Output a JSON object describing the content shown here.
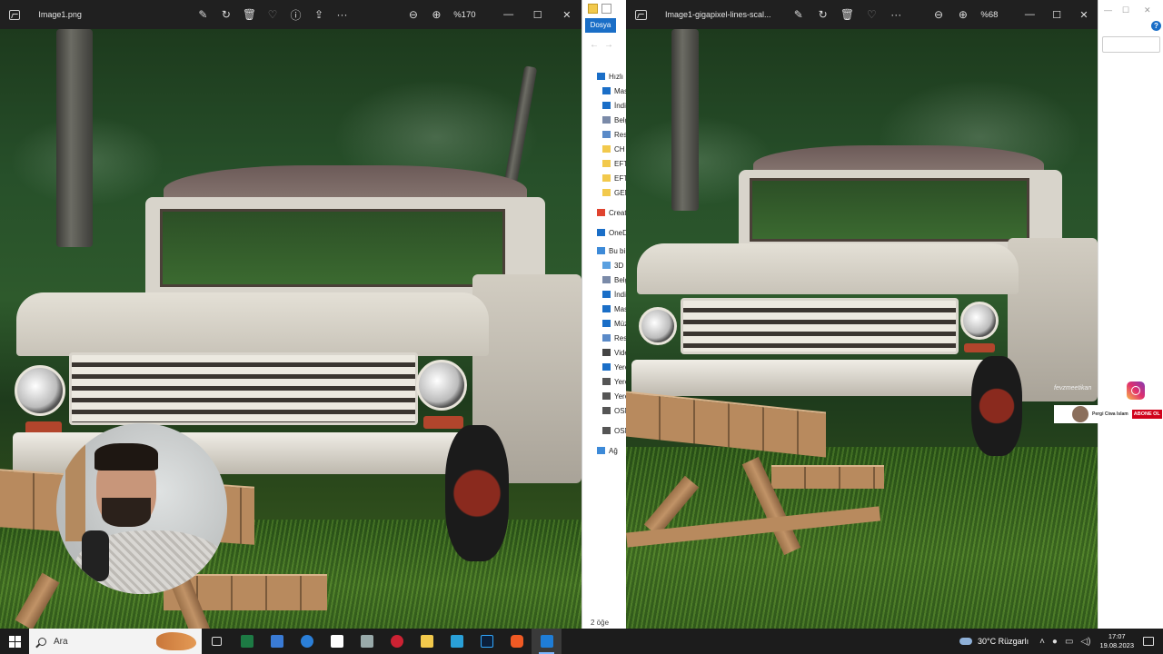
{
  "left_viewer": {
    "filename": "Image1.png",
    "zoom": "%170",
    "toolbar": [
      "edit-image",
      "rotate",
      "delete",
      "favorite",
      "info",
      "share",
      "more"
    ]
  },
  "right_viewer": {
    "filename": "Image1-gigapixel-lines-scal...",
    "zoom": "%68"
  },
  "explorer": {
    "ribbon_tab": "Dosya",
    "items": [
      {
        "label": "Hızlı",
        "icon": "star-icon",
        "color": "#1a6ec7"
      },
      {
        "label": "Mas",
        "icon": "desktop-icon",
        "color": "#1a6ec7"
      },
      {
        "label": "İndi",
        "icon": "download-icon",
        "color": "#1a6ec7"
      },
      {
        "label": "Belg",
        "icon": "document-icon",
        "color": "#7a8aa8"
      },
      {
        "label": "Resi",
        "icon": "pictures-icon",
        "color": "#5a8ac8"
      },
      {
        "label": "CH",
        "icon": "folder-icon",
        "color": "#f2c94c"
      },
      {
        "label": "EFT",
        "icon": "folder-icon",
        "color": "#f2c94c"
      },
      {
        "label": "EFT",
        "icon": "folder-icon",
        "color": "#f2c94c"
      },
      {
        "label": "GEN",
        "icon": "folder-icon",
        "color": "#f2c94c"
      },
      {
        "label": "Creat",
        "icon": "creative-cloud-icon",
        "color": "#e0432f"
      },
      {
        "label": "OneD",
        "icon": "onedrive-icon",
        "color": "#1a6ec7"
      },
      {
        "label": "Bu bi",
        "icon": "computer-icon",
        "color": "#3d8ad8"
      },
      {
        "label": "3D",
        "icon": "3d-objects-icon",
        "color": "#5aa0e0"
      },
      {
        "label": "Belg",
        "icon": "document-icon",
        "color": "#7a8aa8"
      },
      {
        "label": "İndi",
        "icon": "download-icon",
        "color": "#1a6ec7"
      },
      {
        "label": "Mas",
        "icon": "desktop-icon",
        "color": "#1a6ec7"
      },
      {
        "label": "Müz",
        "icon": "music-icon",
        "color": "#1a6ec7"
      },
      {
        "label": "Resi",
        "icon": "pictures-icon",
        "color": "#5a8ac8"
      },
      {
        "label": "Vide",
        "icon": "video-icon",
        "color": "#444"
      },
      {
        "label": "Yere",
        "icon": "windows-drive-icon",
        "color": "#1a6ec7"
      },
      {
        "label": "Yere",
        "icon": "drive-icon",
        "color": "#555"
      },
      {
        "label": "Yere",
        "icon": "drive-icon",
        "color": "#555"
      },
      {
        "label": "OSM",
        "icon": "drive-icon",
        "color": "#555"
      },
      {
        "label": "OSM",
        "icon": "drive-icon",
        "color": "#555"
      },
      {
        "label": "Ağ",
        "icon": "network-icon",
        "color": "#3d8ad8"
      }
    ],
    "status": "2 öğe"
  },
  "overlay": {
    "handle": "fevzmeetikan",
    "channel_name": "Pergi Ciwa Islam",
    "subscribe_label": "ABONE OL"
  },
  "taskbar": {
    "search_placeholder": "Ara",
    "weather": "30°C  Rüzgarlı",
    "time": "17:07",
    "date": "19.08.2023"
  }
}
